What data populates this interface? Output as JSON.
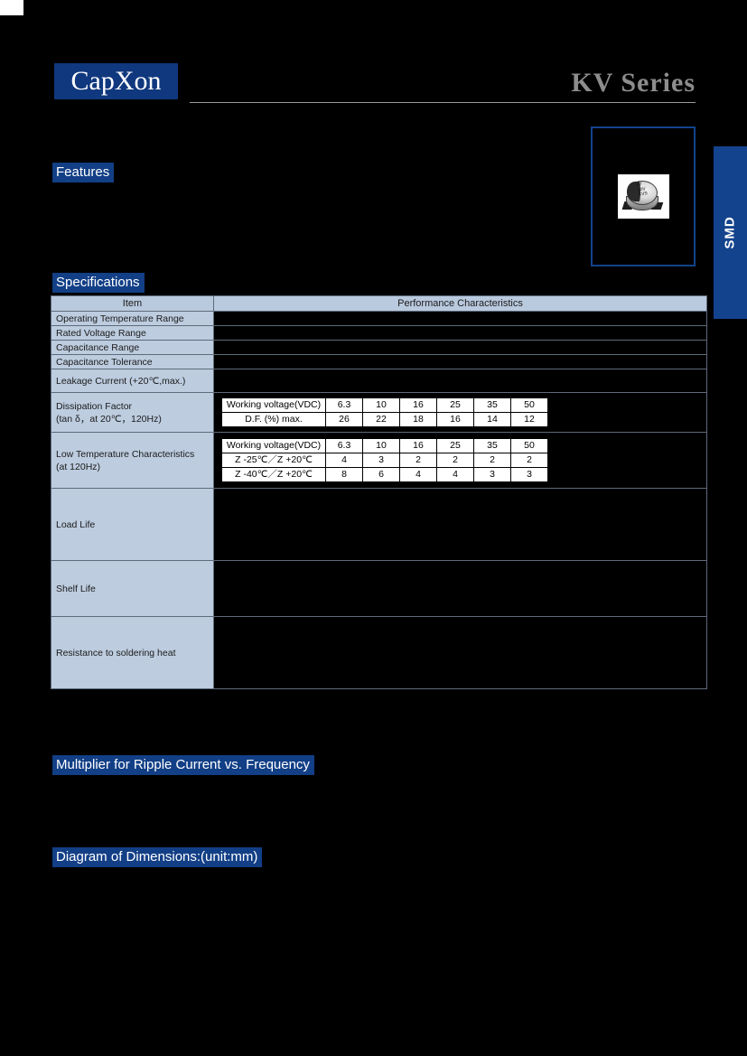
{
  "page": {
    "background_color": "#000000",
    "accent_blue": "#123f86",
    "logo_blue": "#10387e",
    "panel_blue": "#bdccdf",
    "title_gray": "#8d8d8d"
  },
  "header": {
    "logo_text": "CapXon",
    "series_title": "KV  Series"
  },
  "side_tab": {
    "label": "SMD"
  },
  "product_image": {
    "marking_line1": "47",
    "marking_line2": "10V",
    "marking_line3": "KVS"
  },
  "sections": {
    "features": "Features",
    "specifications": "Specifications",
    "multiplier": "Multiplier for Ripple Current vs. Frequency",
    "diagram": "Diagram of Dimensions:(unit:mm)"
  },
  "spec_table": {
    "header_item": "Item",
    "header_performance": "Performance Characteristics",
    "rows": [
      {
        "item": "Operating Temperature Range",
        "value": ""
      },
      {
        "item": "Rated Voltage Range",
        "value": ""
      },
      {
        "item": "Capacitance Range",
        "value": ""
      },
      {
        "item": "Capacitance Tolerance",
        "value": ""
      },
      {
        "item": "Leakage Current (+20℃,max.)",
        "value": ""
      },
      {
        "item_line1": "Dissipation Factor",
        "item_line2": "(tan δ，at 20℃，120Hz)"
      },
      {
        "item_line1": "Low Temperature Characteristics",
        "item_line2": "(at 120Hz)"
      },
      {
        "item": "Load Life",
        "value": ""
      },
      {
        "item": "Shelf Life",
        "value": ""
      },
      {
        "item": "Resistance to soldering heat",
        "value": ""
      }
    ]
  },
  "dissipation_factor_table": {
    "rows": [
      {
        "label": "Working voltage(VDC)",
        "values": [
          "6.3",
          "10",
          "16",
          "25",
          "35",
          "50"
        ]
      },
      {
        "label": "D.F. (%) max.",
        "values": [
          "26",
          "22",
          "18",
          "16",
          "14",
          "12"
        ]
      }
    ]
  },
  "low_temperature_table": {
    "rows": [
      {
        "label": "Working voltage(VDC)",
        "values": [
          "6.3",
          "10",
          "16",
          "25",
          "35",
          "50"
        ]
      },
      {
        "label": "Z -25℃／Z +20℃",
        "values": [
          "4",
          "3",
          "2",
          "2",
          "2",
          "2"
        ]
      },
      {
        "label": "Z -40℃／Z +20℃",
        "values": [
          "8",
          "6",
          "4",
          "4",
          "3",
          "3"
        ]
      }
    ]
  }
}
